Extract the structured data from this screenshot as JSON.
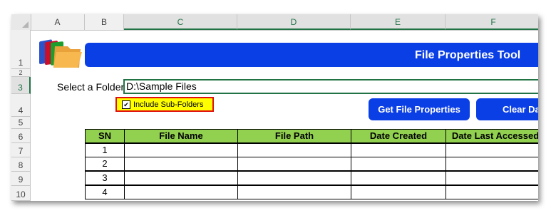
{
  "columns": [
    "A",
    "B",
    "C",
    "D",
    "E",
    "F"
  ],
  "rows": [
    "1",
    "2",
    "3",
    "4",
    "5",
    "6",
    "7",
    "8",
    "9",
    "10"
  ],
  "banner": {
    "title": "File Properties Tool"
  },
  "folder": {
    "label": "Select a Folder",
    "value": "D:\\Sample Files"
  },
  "option": {
    "checked": true,
    "check_mark": "✔",
    "label": "Include Sub-Folders"
  },
  "buttons": {
    "get": "Get File Properties",
    "clear": "Clear Da"
  },
  "table": {
    "headers": [
      "SN",
      "File Name",
      "File Path",
      "Date Created",
      "Date Last Accessed"
    ],
    "sn": [
      "1",
      "2",
      "3",
      "4"
    ]
  },
  "colors": {
    "accent": "#0b3fe6",
    "header_green": "#92d050",
    "highlight": "#ffff00",
    "alert": "#e01010",
    "excel_green": "#217346"
  },
  "icons": {
    "banner_icon": "folders-icon"
  }
}
